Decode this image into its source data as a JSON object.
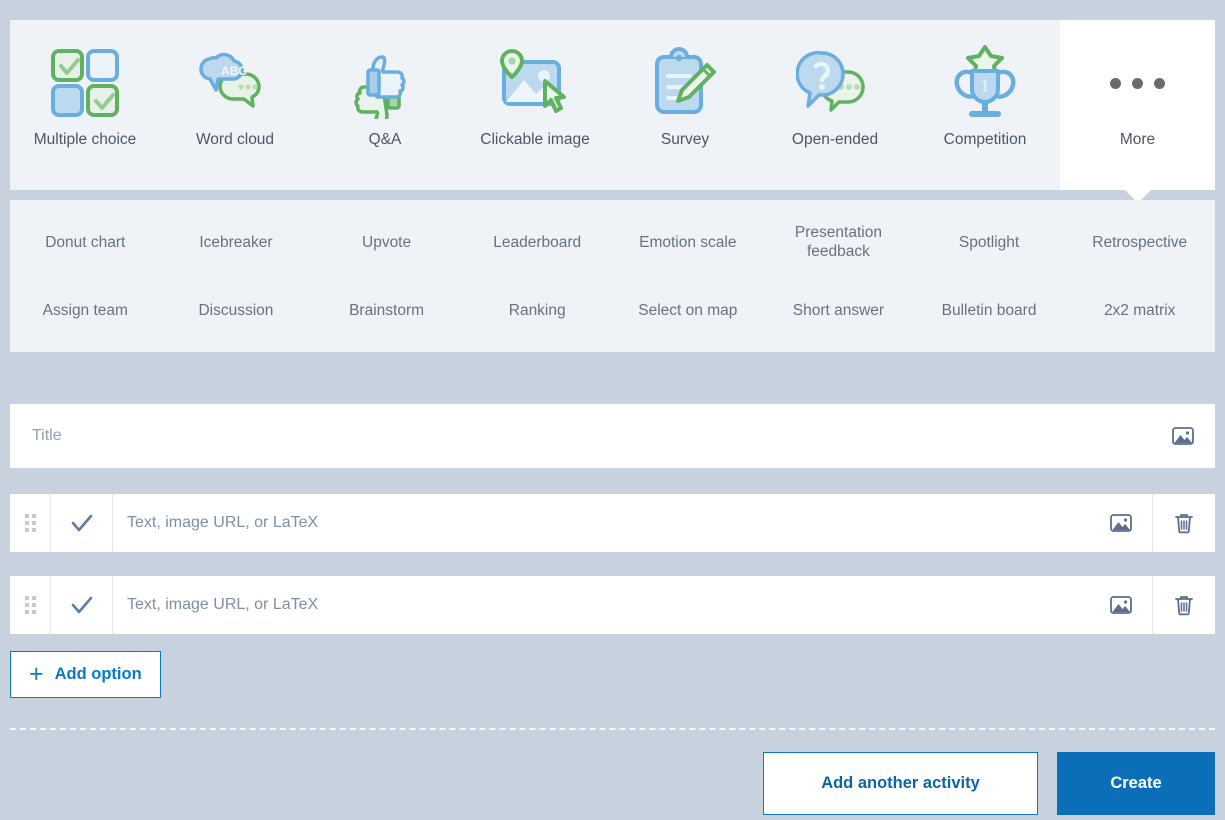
{
  "activity_types": [
    {
      "label": "Multiple choice",
      "icon": "multiple-choice-icon"
    },
    {
      "label": "Word cloud",
      "icon": "word-cloud-icon"
    },
    {
      "label": "Q&A",
      "icon": "qa-thumbs-icon"
    },
    {
      "label": "Clickable image",
      "icon": "clickable-image-icon"
    },
    {
      "label": "Survey",
      "icon": "survey-clipboard-icon"
    },
    {
      "label": "Open-ended",
      "icon": "open-ended-icon"
    },
    {
      "label": "Competition",
      "icon": "competition-trophy-icon"
    },
    {
      "label": "More",
      "icon": "more-dots-icon"
    }
  ],
  "more_panel": {
    "row1": [
      "Donut chart",
      "Icebreaker",
      "Upvote",
      "Leaderboard",
      "Emotion scale",
      "Presentation feedback",
      "Spotlight",
      "Retrospective"
    ],
    "row2": [
      "Assign team",
      "Discussion",
      "Brainstorm",
      "Ranking",
      "Select on map",
      "Short answer",
      "Bulletin board",
      "2x2 matrix"
    ]
  },
  "form": {
    "title_placeholder": "Title",
    "title_value": "",
    "options": [
      {
        "placeholder": "Text, image URL, or LaTeX",
        "value": "",
        "correct": true
      },
      {
        "placeholder": "Text, image URL, or LaTeX",
        "value": "",
        "correct": true
      }
    ],
    "add_option_label": "Add option",
    "add_option_plus": "+"
  },
  "footer": {
    "secondary_label": "Add another activity",
    "primary_label": "Create"
  },
  "colors": {
    "page_background": "#c8d2de",
    "panel_background": "#eff3f8",
    "active_tile": "#ffffff",
    "accent_blue": "#0a7ac4",
    "primary_button": "#0a6fb8",
    "icon_blue": "#6aaee0",
    "icon_green": "#5fb25f",
    "label_text": "#4c5763"
  }
}
